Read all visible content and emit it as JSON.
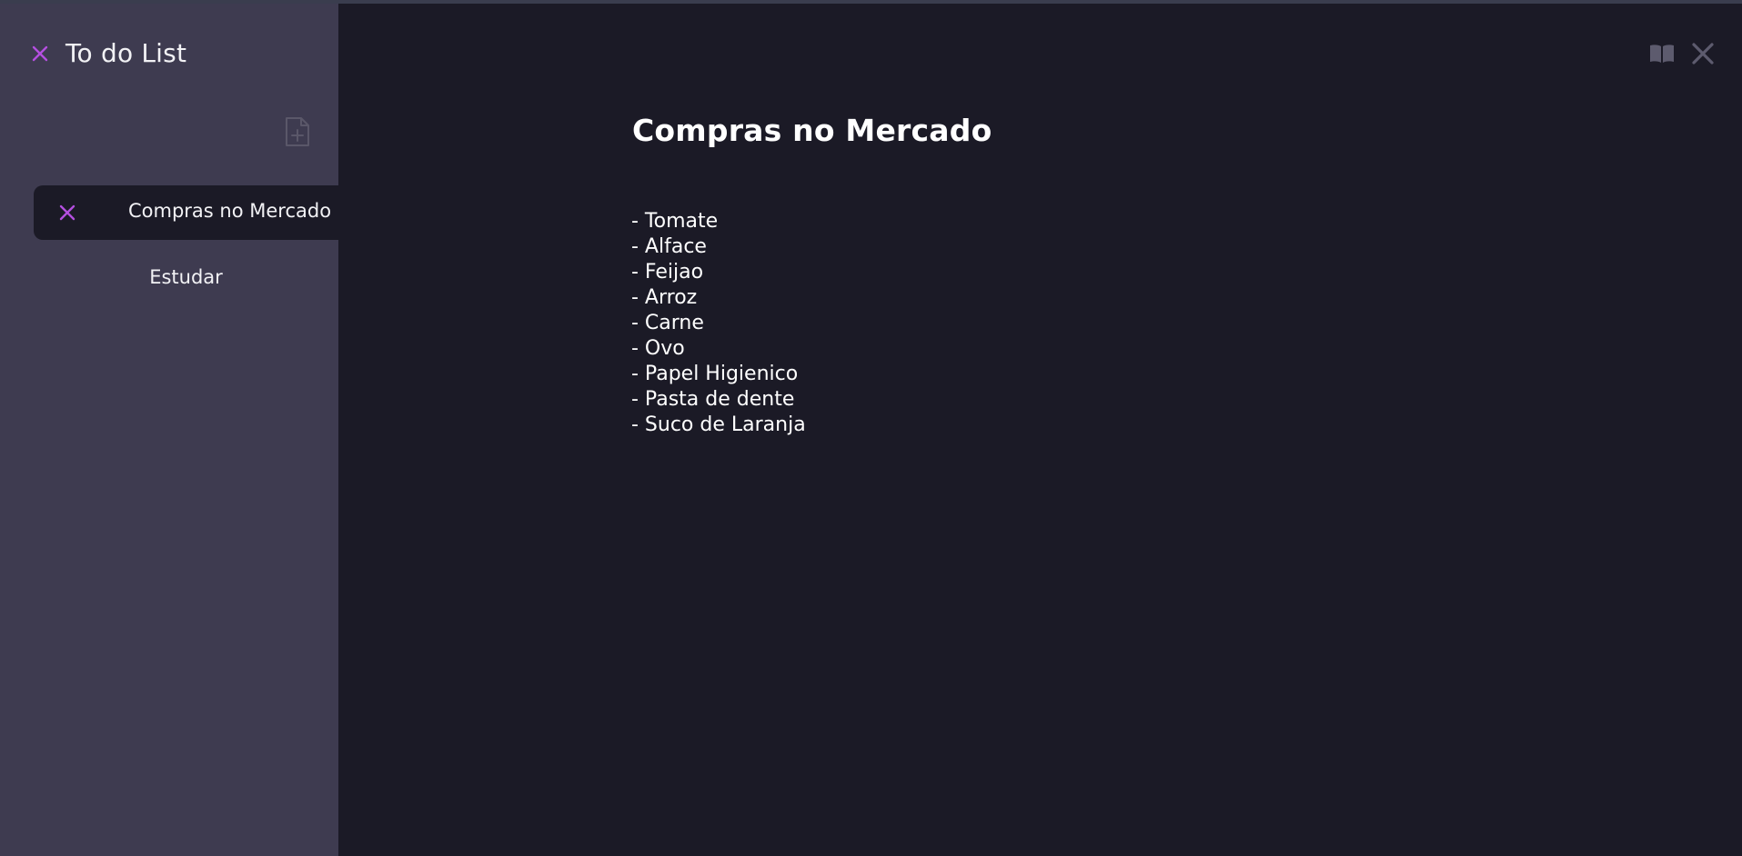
{
  "app": {
    "title": "To do List",
    "accent_color": "#b44fe0"
  },
  "sidebar": {
    "close_icon": "close-icon",
    "new_note_icon": "new-file-icon",
    "items": [
      {
        "label": "Compras no Mercado",
        "active": true,
        "delete_icon": "close-icon"
      },
      {
        "label": "Estudar",
        "active": false
      }
    ]
  },
  "toolbar": {
    "icons": [
      "book-open-icon",
      "close-icon"
    ]
  },
  "note": {
    "title": "Compras no Mercado",
    "lines": [
      "- Tomate",
      "- Alface",
      "- Feijao",
      "- Arroz",
      "- Carne",
      "- Ovo",
      "- Papel Higienico",
      "- Pasta de dente",
      "- Suco de Laranja"
    ]
  }
}
